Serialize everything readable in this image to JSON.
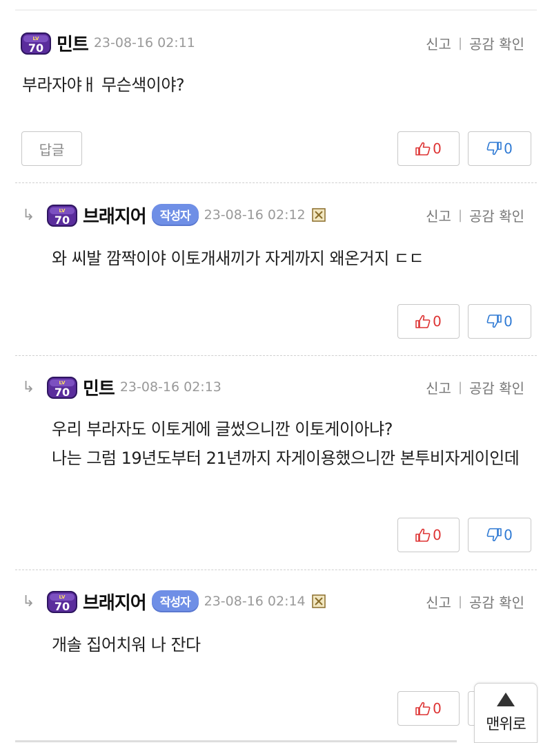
{
  "comments": [
    {
      "nick": "민트",
      "date": "23-08-16 02:11",
      "level": "70",
      "text": "부라자야ㅐ 무슨색이야?",
      "reply_label": "답글",
      "likes": "0",
      "dislikes": "0"
    },
    {
      "nick": "브래지어",
      "author_badge": "작성자",
      "date": "23-08-16 02:12",
      "level": "70",
      "text": "와 씨발 깜짝이야 이토개새끼가 자게까지 왜온거지 ㄷㄷ",
      "likes": "0",
      "dislikes": "0"
    },
    {
      "nick": "민트",
      "date": "23-08-16 02:13",
      "level": "70",
      "text": "우리 부라자도 이토게에 글썼으니깐 이토게이아냐?\n나는 그럼 19년도부터 21년까지 자게이용했으니깐 본투비자게이인데",
      "likes": "0",
      "dislikes": "0"
    },
    {
      "nick": "브래지어",
      "author_badge": "작성자",
      "date": "23-08-16 02:14",
      "level": "70",
      "text": "개솔 집어치워 나 잔다",
      "likes": "0"
    }
  ],
  "actions": {
    "report": "신고",
    "separator": "|",
    "likes_check": "공감 확인"
  },
  "reply_arrow": "↳",
  "scroll_top": {
    "label": "맨위로",
    "icon": "up-triangle-icon"
  },
  "colors": {
    "like": "#dd3333",
    "dislike": "#2f7ad4",
    "author_badge": "#6f8fe6",
    "level_badge": "#5a2d9c"
  }
}
